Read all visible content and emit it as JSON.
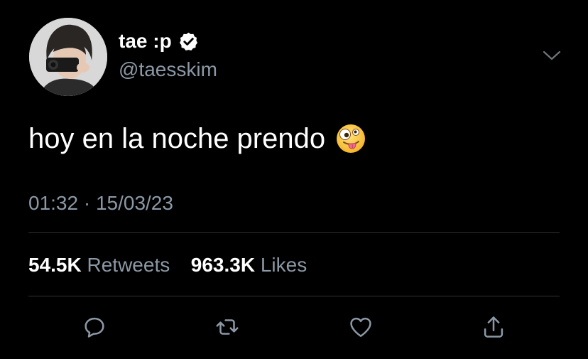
{
  "tweet": {
    "author": {
      "display_name": "tae :p",
      "handle": "@taesskim",
      "verified": true,
      "avatar": "profile-photo"
    },
    "text": "hoy en la noche prendo",
    "emoji": "zany-face",
    "timestamp": "01:32 · 15/03/23",
    "retweets_count": "54.5K",
    "retweets_label": "Retweets",
    "likes_count": "963.3K",
    "likes_label": "Likes"
  },
  "icons": {
    "menu": "chevron-down-icon",
    "reply": "reply-icon",
    "retweet": "retweet-icon",
    "like": "heart-icon",
    "share": "share-icon"
  },
  "colors": {
    "background": "#000000",
    "text_primary": "#ffffff",
    "text_secondary": "#8b98a5",
    "divider": "#2f3336",
    "icon": "#8b98a5"
  }
}
